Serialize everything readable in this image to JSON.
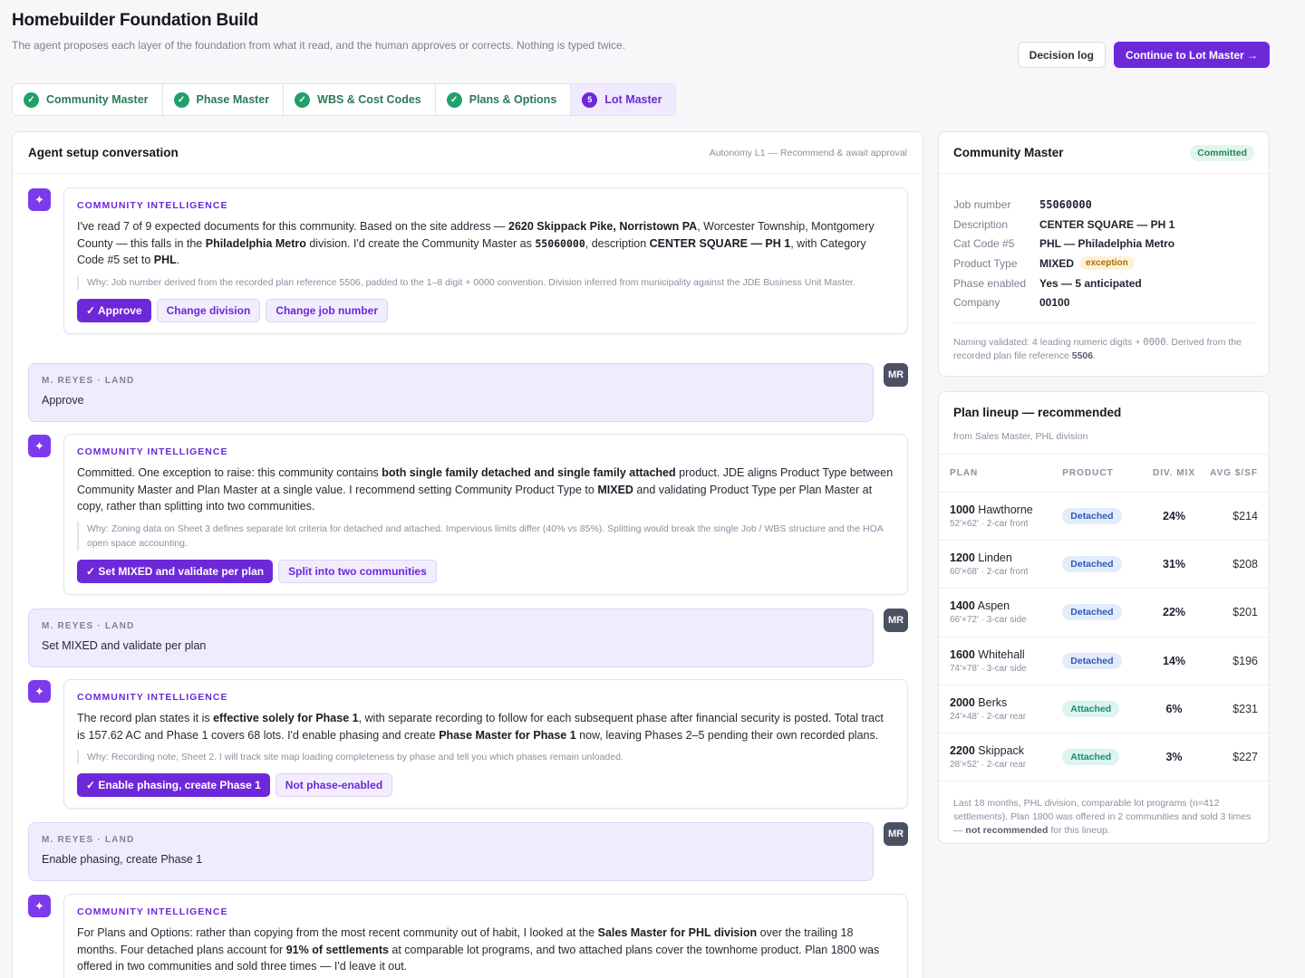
{
  "header": {
    "title": "Homebuilder Foundation Build",
    "subtitle": "The agent proposes each layer of the foundation from what it read, and the human approves or corrects. Nothing is typed twice.",
    "decision_log": "Decision log",
    "continue": "Continue to Lot Master →"
  },
  "tabs": [
    {
      "label": "Community Master",
      "status": "done"
    },
    {
      "label": "Phase Master",
      "status": "done"
    },
    {
      "label": "WBS & Cost Codes",
      "status": "done"
    },
    {
      "label": "Plans & Options",
      "status": "done"
    },
    {
      "label": "Lot Master",
      "status": "active",
      "num": "5"
    }
  ],
  "conversation": {
    "title": "Agent setup conversation",
    "autonomy": "Autonomy L1 — Recommend & await approval",
    "agent_label": "COMMUNITY INTELLIGENCE",
    "agent_icon": "✦",
    "human_name": "M. REYES · LAND",
    "avatar": "MR",
    "m1": {
      "t1": "I've read 7 of 9 expected documents for this community. Based on the site address — ",
      "b1": "2620 Skippack Pike, Norristown PA",
      "t2": ", Worcester Township, Montgomery County — this falls in the ",
      "b2": "Philadelphia Metro",
      "t3": " division. I'd create the Community Master as ",
      "code1": "55060000",
      "t4": ", description ",
      "b3": "CENTER SQUARE — PH 1",
      "t5": ", with Category Code #5 set to ",
      "b4": "PHL",
      "t6": ".",
      "why": "Why: Job number derived from the recorded plan reference 5506, padded to the 1–8 digit + 0000 convention. Division inferred from municipality against the JDE Business Unit Master.",
      "a1": "✓ Approve",
      "a2": "Change division",
      "a3": "Change job number"
    },
    "h1": "Approve",
    "m2": {
      "t1": "Committed. One exception to raise: this community contains ",
      "b1": "both single family detached and single family attached",
      "t2": " product. JDE aligns Product Type between Community Master and Plan Master at a single value. I recommend setting Community Product Type to ",
      "b2": "MIXED",
      "t3": " and validating Product Type per Plan Master at copy, rather than splitting into two communities.",
      "why": "Why: Zoning data on Sheet 3 defines separate lot criteria for detached and attached. Impervious limits differ (40% vs 85%). Splitting would break the single Job / WBS structure and the HOA open space accounting.",
      "a1": "✓ Set MIXED and validate per plan",
      "a2": "Split into two communities"
    },
    "h2": "Set MIXED and validate per plan",
    "m3": {
      "t1": "The record plan states it is ",
      "b1": "effective solely for Phase 1",
      "t2": ", with separate recording to follow for each subsequent phase after financial security is posted. Total tract is 157.62 AC and Phase 1 covers 68 lots. I'd enable phasing and create ",
      "b2": "Phase Master for Phase 1",
      "t3": " now, leaving Phases 2–5 pending their own recorded plans.",
      "why": "Why: Recording note, Sheet 2. I will track site map loading completeness by phase and tell you which phases remain unloaded.",
      "a1": "✓ Enable phasing, create Phase 1",
      "a2": "Not phase-enabled"
    },
    "h3": "Enable phasing, create Phase 1",
    "m4": {
      "t1": "For Plans and Options: rather than copying from the most recent community out of habit, I looked at the ",
      "b1": "Sales Master for PHL division",
      "t2": " over the trailing 18 months. Four detached plans account for ",
      "b2": "91% of settlements",
      "t3": " at comparable lot programs, and two attached plans cover the townhome product. Plan 1800 was offered in two communities and sold three times — I'd leave it out."
    }
  },
  "community_master": {
    "title": "Community Master",
    "status": "Committed",
    "fields": [
      {
        "k": "Job number",
        "v": "55060000"
      },
      {
        "k": "Description",
        "v": "CENTER SQUARE — PH 1"
      },
      {
        "k": "Cat Code #5",
        "v": "PHL — Philadelphia Metro"
      },
      {
        "k": "Product Type",
        "v": "MIXED",
        "badge": "exception"
      },
      {
        "k": "Phase enabled",
        "v": "Yes — 5 anticipated"
      },
      {
        "k": "Company",
        "v": "00100"
      }
    ],
    "note_t1": "Naming validated: 4 leading numeric digits + ",
    "note_code": "0000",
    "note_t2": ". Derived from the recorded plan file reference ",
    "note_b": "5506",
    "note_t3": "."
  },
  "plan_lineup": {
    "title": "Plan lineup — recommended",
    "subtitle": "from Sales Master, PHL division",
    "columns": [
      "PLAN",
      "PRODUCT",
      "DIV. MIX",
      "AVG $/SF"
    ],
    "rows": [
      {
        "num": "1000",
        "name": "Hawthorne",
        "dim": "52'×62' · 2-car front",
        "product": "Detached",
        "mix": "24%",
        "psf": "$214"
      },
      {
        "num": "1200",
        "name": "Linden",
        "dim": "60'×68' · 2-car front",
        "product": "Detached",
        "mix": "31%",
        "psf": "$208"
      },
      {
        "num": "1400",
        "name": "Aspen",
        "dim": "66'×72' · 3-car side",
        "product": "Detached",
        "mix": "22%",
        "psf": "$201"
      },
      {
        "num": "1600",
        "name": "Whitehall",
        "dim": "74'×78' · 3-car side",
        "product": "Detached",
        "mix": "14%",
        "psf": "$196"
      },
      {
        "num": "2000",
        "name": "Berks",
        "dim": "24'×48' · 2-car rear",
        "product": "Attached",
        "mix": "6%",
        "psf": "$231"
      },
      {
        "num": "2200",
        "name": "Skippack",
        "dim": "28'×52' · 2-car rear",
        "product": "Attached",
        "mix": "3%",
        "psf": "$227"
      }
    ],
    "note_t1": "Last 18 months, PHL division, comparable lot programs (n=412 settlements). Plan 1800 was offered in 2 communities and sold 3 times — ",
    "note_b": "not recommended",
    "note_t2": " for this lineup."
  }
}
